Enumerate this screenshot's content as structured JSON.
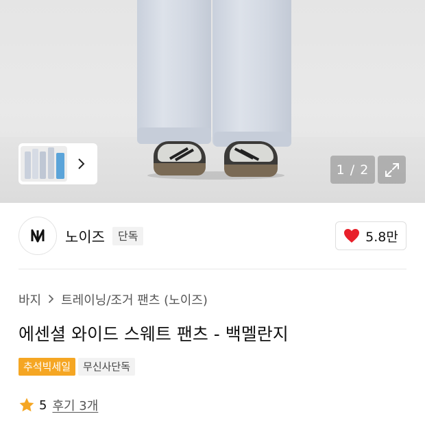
{
  "gallery": {
    "counter_text": "1 / 2",
    "thumbnail_next_icon": "chevron-right-icon",
    "expand_icon": "expand-icon"
  },
  "brand": {
    "logo_icon": "brand-logo-icon",
    "name": "노이즈",
    "exclusive_label": "단독",
    "likes": "5.8만",
    "like_icon": "heart-icon",
    "like_color": "#e8202a"
  },
  "breadcrumb": {
    "items": [
      "바지",
      "트레이닝/조거 팬츠 (노이즈)"
    ],
    "separator_icon": "chevron-right-icon"
  },
  "product": {
    "title": "에센셜 와이드 스웨트 팬츠 - 백멜란지",
    "tags": [
      "추석빅세일",
      "무신사단독"
    ],
    "tag_sale_color": "#f5a623"
  },
  "rating": {
    "star_icon": "star-icon",
    "star_color": "#f5a623",
    "score": "5",
    "review_text": "후기 3개"
  }
}
